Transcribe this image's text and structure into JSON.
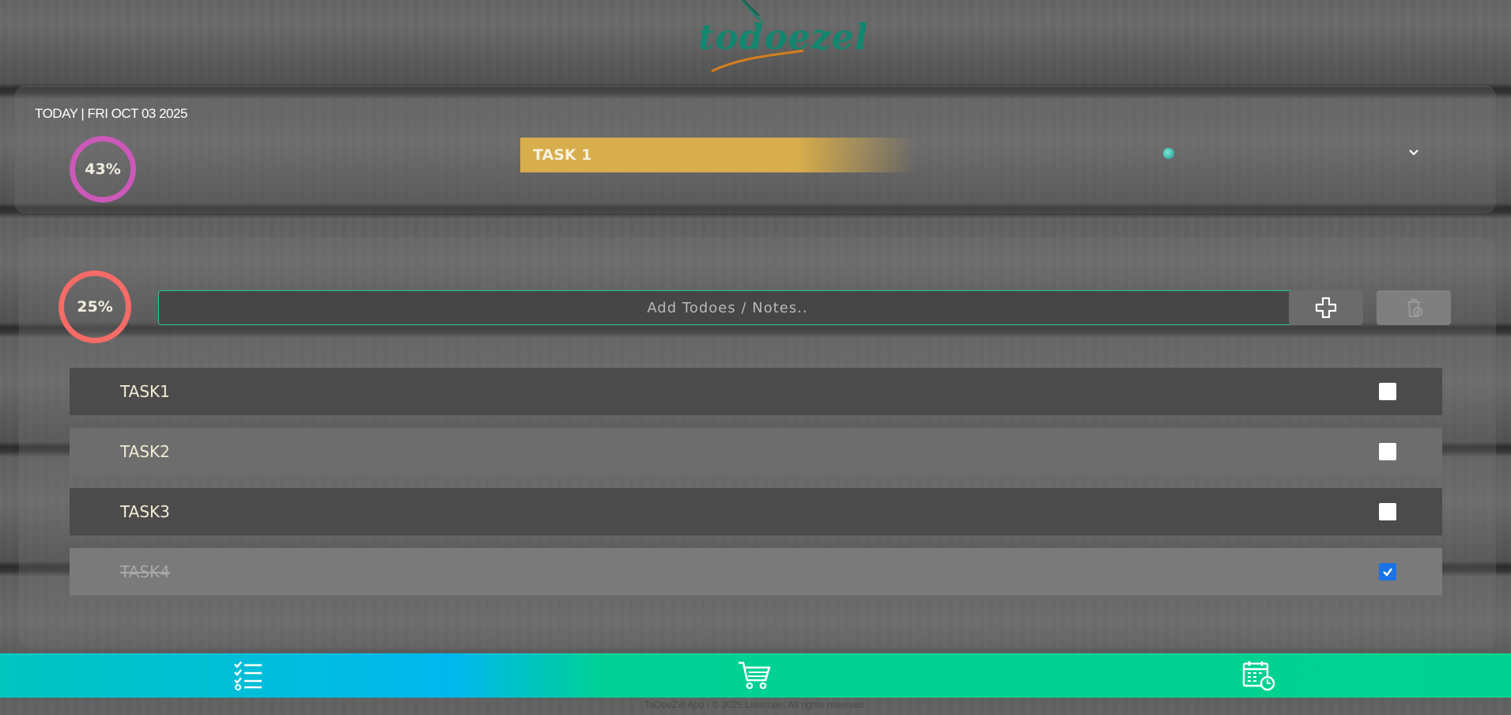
{
  "brand": {
    "name": "todoezel",
    "color": "#13866f"
  },
  "today": {
    "label": "TODAY | FRI OCT 03 2025",
    "progress_percent": 43,
    "progress_label": "43%",
    "ring_color": "#cc58b8"
  },
  "banner": {
    "task_name": "TASK 1",
    "color": "#d8ad4b"
  },
  "icons": {
    "expand": "chevron-down-icon",
    "add": "plus-icon",
    "delete": "trash-icon"
  },
  "list": {
    "progress_percent": 25,
    "progress_label": "25%",
    "ring_color": "#f56b66",
    "input_placeholder": "Add Todoes / Notes..",
    "tasks": [
      {
        "label": "TASK1",
        "done": false
      },
      {
        "label": "TASK2",
        "done": false
      },
      {
        "label": "TASK3",
        "done": false
      },
      {
        "label": "TASK4",
        "done": true
      }
    ]
  },
  "nav": {
    "accent": "#00d391",
    "items": [
      {
        "icon": "checklist-icon"
      },
      {
        "icon": "cart-icon"
      },
      {
        "icon": "calendar-clock-icon"
      }
    ]
  },
  "footer": {
    "text": "ToDoeZel App | © 2025 Liascope. All rights reserved."
  }
}
